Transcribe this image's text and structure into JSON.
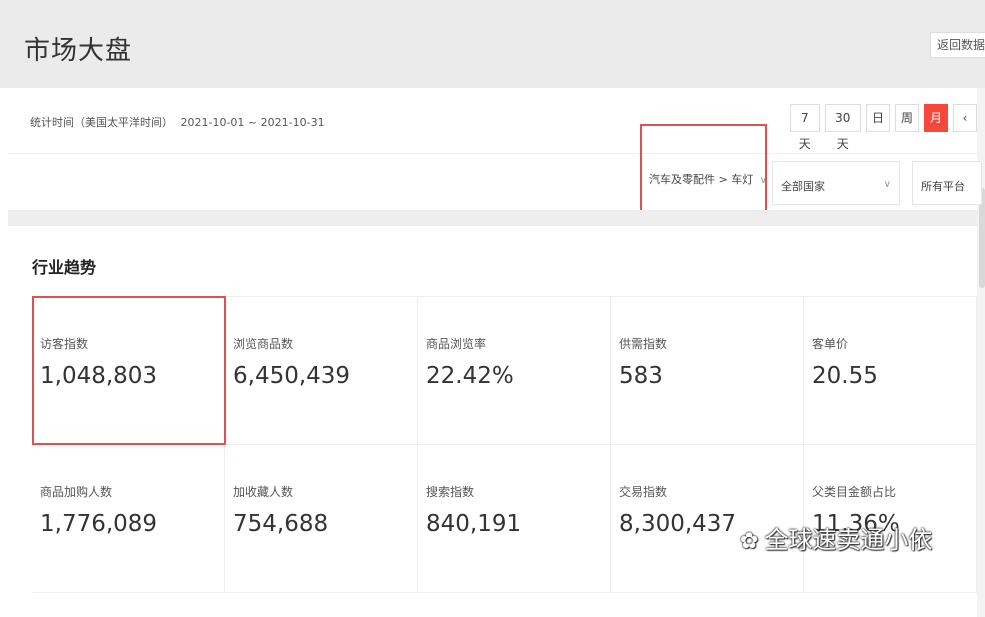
{
  "header": {
    "title": "市场大盘",
    "back_button": "返回数据"
  },
  "date_bar": {
    "label": "统计时间（美国太平洋时间）",
    "range": "2021-10-01 ~ 2021-10-31",
    "periods": [
      {
        "label": "7天",
        "active": false
      },
      {
        "label": "30天",
        "active": false
      },
      {
        "label": "日",
        "active": false
      },
      {
        "label": "周",
        "active": false
      },
      {
        "label": "月",
        "active": true
      },
      {
        "label": "‹",
        "active": false
      }
    ]
  },
  "filters": {
    "category": "汽车及零配件 > 车灯",
    "country": "全部国家",
    "platform": "所有平台"
  },
  "section": {
    "title": "行业趋势"
  },
  "metrics": [
    {
      "label": "访客指数",
      "value": "1,048,803"
    },
    {
      "label": "浏览商品数",
      "value": "6,450,439"
    },
    {
      "label": "商品浏览率",
      "value": "22.42%"
    },
    {
      "label": "供需指数",
      "value": "583"
    },
    {
      "label": "客单价",
      "value": "20.55"
    },
    {
      "label": "商品加购人数",
      "value": "1,776,089"
    },
    {
      "label": "加收藏人数",
      "value": "754,688"
    },
    {
      "label": "搜索指数",
      "value": "840,191"
    },
    {
      "label": "交易指数",
      "value": "8,300,437"
    },
    {
      "label": "父类目金额占比",
      "value": "11.36%"
    }
  ],
  "watermark": "全球速卖通小依",
  "colors": {
    "accent": "#f5483b",
    "highlight": "#e05050",
    "header_bg": "#ebebeb"
  }
}
